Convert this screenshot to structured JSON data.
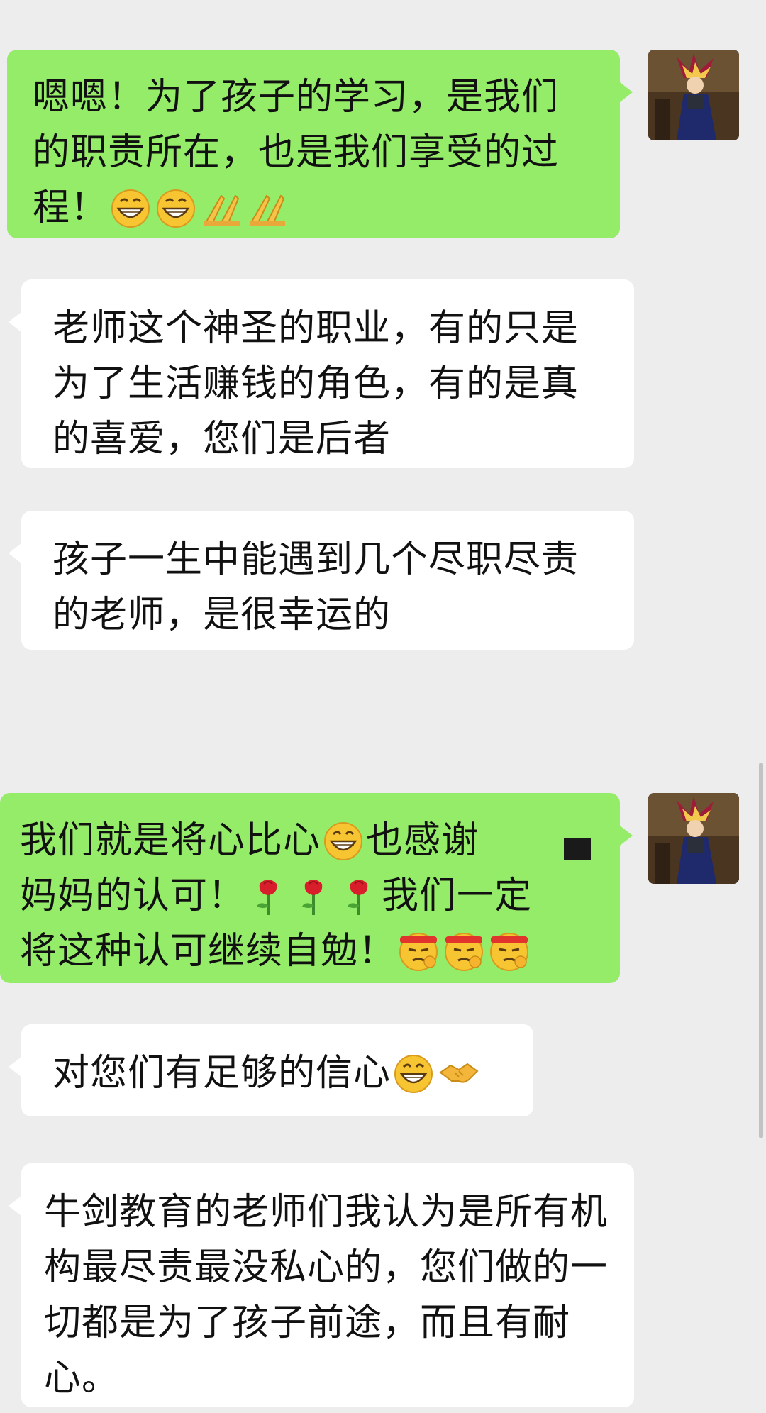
{
  "messages": [
    {
      "side": "me",
      "text_parts": [
        "嗯嗯！为了孩子的学习，是我们的职责所在，也是我们享受的过程！"
      ],
      "emojis": [
        "grin-emoji",
        "grin-emoji",
        "pray-emoji",
        "pray-emoji"
      ]
    },
    {
      "side": "them",
      "text": "老师这个神圣的职业，有的只是为了生活赚钱的角色，有的是真的喜爱，您们是后者"
    },
    {
      "side": "them",
      "text": "孩子一生中能遇到几个尽职尽责的老师，是很幸运的"
    },
    {
      "side": "me",
      "text_parts": [
        "我们就是将心比心",
        "也感谢",
        "妈妈的认可！",
        "我们一定",
        "将这种认可继续自勉！"
      ],
      "emojis": [
        "grin-emoji",
        "rose-emoji",
        "rose-emoji",
        "rose-emoji",
        "determined-emoji",
        "determined-emoji",
        "determined-emoji"
      ]
    },
    {
      "side": "them",
      "text_parts": [
        "对您们有足够的信心"
      ],
      "emojis": [
        "grin-emoji",
        "handshake-emoji"
      ]
    },
    {
      "side": "them",
      "text": "牛剑教育的老师们我认为是所有机构最尽责最没私心的，您们做的一切都是为了孩子前途，而且有耐心。"
    }
  ],
  "colors": {
    "background": "#ededed",
    "my_bubble": "#95ec69",
    "their_bubble": "#ffffff",
    "text": "#111111"
  }
}
